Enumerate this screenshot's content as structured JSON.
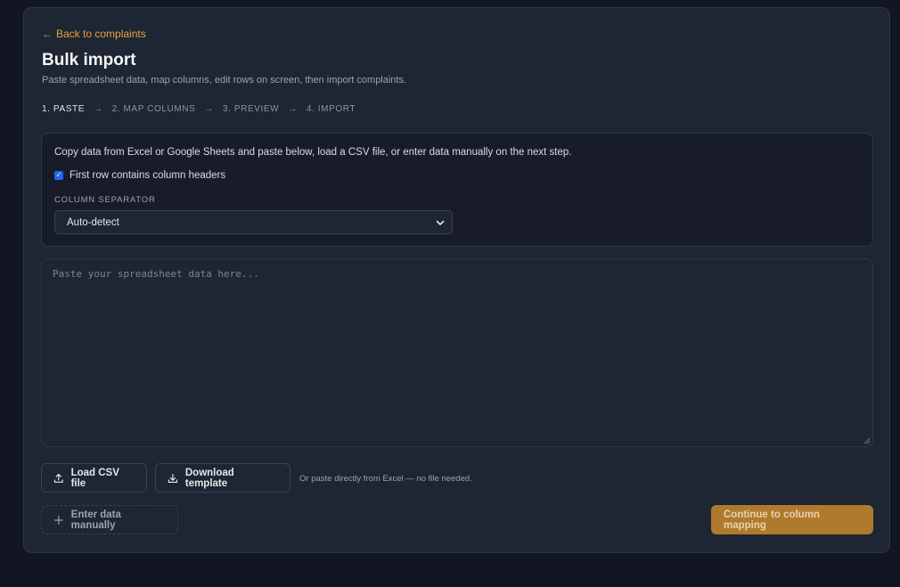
{
  "header": {
    "back_link": "Back to complaints",
    "title": "Bulk import",
    "subtitle": "Paste spreadsheet data, map columns, edit rows on screen, then import complaints."
  },
  "steps": [
    {
      "label": "1. PASTE",
      "active": true
    },
    {
      "label": "2. MAP COLUMNS",
      "active": false
    },
    {
      "label": "3. PREVIEW",
      "active": false
    },
    {
      "label": "4. IMPORT",
      "active": false
    }
  ],
  "options": {
    "instructions": "Copy data from Excel or Google Sheets and paste below, load a CSV file, or enter data manually on the next step.",
    "header_checkbox_label": "First row contains column headers",
    "header_checkbox_checked": true,
    "separator_label": "COLUMN SEPARATOR",
    "separator_value": "Auto-detect"
  },
  "paste_area": {
    "placeholder": "Paste your spreadsheet data here..."
  },
  "actions": {
    "load_csv": "Load CSV file",
    "download_template": "Download template",
    "hint": "Or paste directly from Excel — no file needed.",
    "enter_manually": "Enter data manually",
    "continue": "Continue to column mapping"
  },
  "icons": {
    "back": "arrow-left-icon",
    "select": "chevron-down-icon",
    "upload": "upload-icon",
    "download": "download-icon",
    "plus": "plus-icon"
  },
  "colors": {
    "accent": "#e8a33a",
    "continue_bg": "#b07a2c",
    "checkbox": "#2563eb"
  }
}
